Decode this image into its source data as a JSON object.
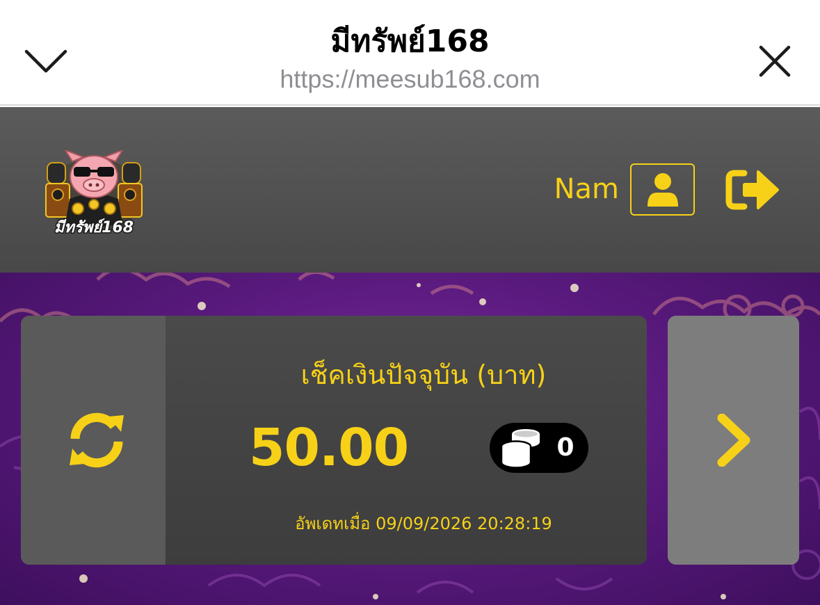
{
  "browser": {
    "title": "มีทรัพย์168",
    "url": "https://meesub168.com",
    "chevron_icon": "chevron-down-icon",
    "close_icon": "close-icon"
  },
  "header": {
    "logo_text": "มีทรัพย์168",
    "username": "Nam",
    "profile_icon": "user-icon",
    "logout_icon": "logout-icon"
  },
  "wallet": {
    "label": "เช็คเงินปัจจุบัน (บาท)",
    "balance": "50.00",
    "coin_count": "0",
    "updated_text": "อัพเดทเมื่อ 09/09/2026 20:28:19",
    "refresh_icon": "refresh-icon",
    "next_icon": "chevron-right-icon",
    "coins_icon": "coins-icon"
  },
  "colors": {
    "accent": "#f7d117",
    "header_bg": "#505050",
    "banner_bg": "#5a1a7e"
  }
}
